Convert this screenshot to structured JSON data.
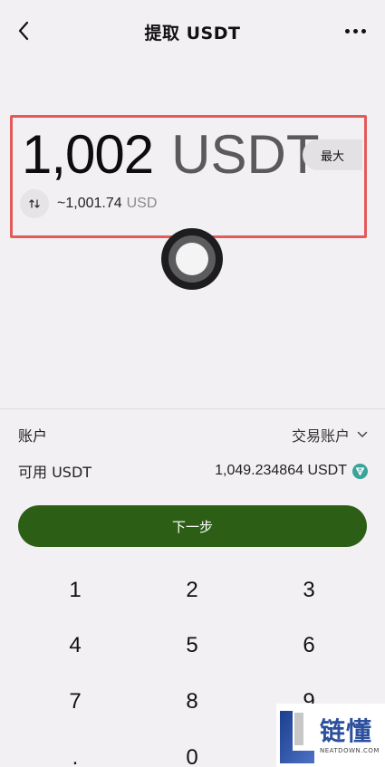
{
  "header": {
    "title": "提取 USDT"
  },
  "amount": {
    "value": "1,002",
    "unit": "USDT",
    "max_label": "最大",
    "approx_value": "~1,001.74",
    "approx_unit": "USD"
  },
  "account": {
    "label": "账户",
    "selected": "交易账户"
  },
  "available": {
    "label": "可用 USDT",
    "value": "1,049.234864 USDT"
  },
  "next_button": "下一步",
  "keypad": {
    "keys": [
      "1",
      "2",
      "3",
      "4",
      "5",
      "6",
      "7",
      "8",
      "9",
      ".",
      "0"
    ]
  },
  "watermark": {
    "cn": "链懂",
    "en": "NEATDOWN.COM"
  },
  "colors": {
    "primary_button": "#2d5e16",
    "highlight_border": "#e35a5a",
    "tron_badge": "#3aa39a"
  }
}
